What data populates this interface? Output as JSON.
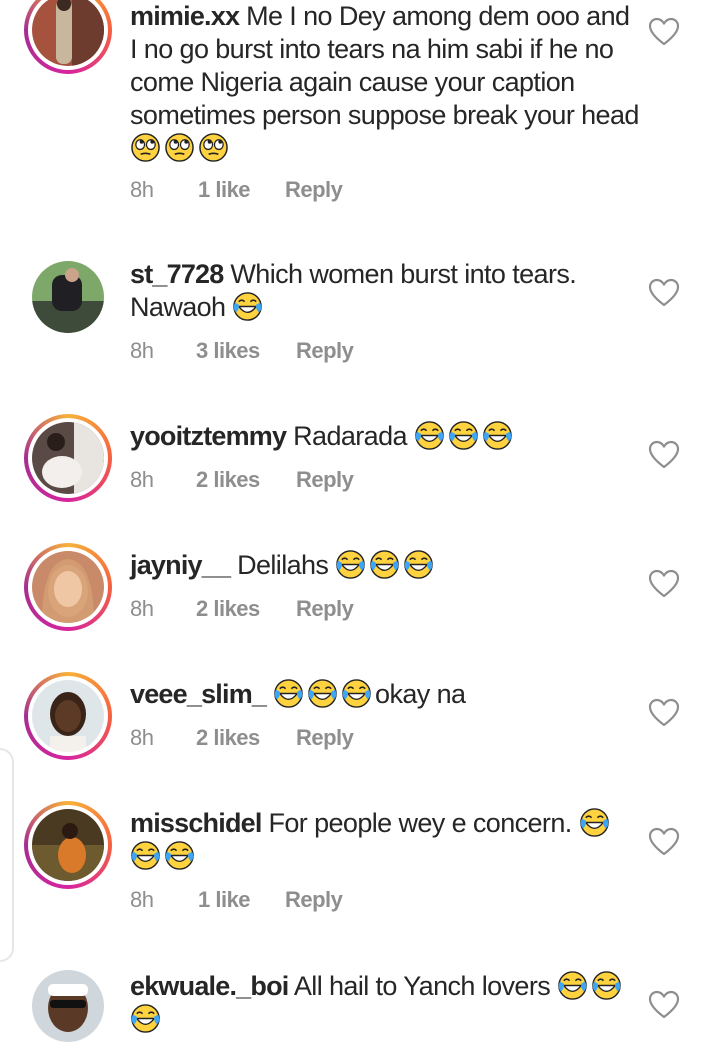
{
  "comments": [
    {
      "username": "mimie.xx",
      "text": "Me I no Dey among dem ooo and I no go burst into tears na him sabi if he no come Nigeria again cause your caption sometimes person suppose break your head",
      "emojis": [
        "rolling-eyes",
        "rolling-eyes",
        "rolling-eyes"
      ],
      "time": "8h",
      "likes": "1 like",
      "reply": "Reply"
    },
    {
      "username": "st_7728",
      "text": "Which women burst into tears. Nawaoh",
      "emojis": [
        "tears-of-joy"
      ],
      "time": "8h",
      "likes": "3 likes",
      "reply": "Reply"
    },
    {
      "username": "yooitztemmy",
      "text": "Radarada",
      "emojis": [
        "tears-of-joy",
        "tears-of-joy",
        "tears-of-joy"
      ],
      "time": "8h",
      "likes": "2 likes",
      "reply": "Reply"
    },
    {
      "username": "jayniy__",
      "text": "Delilahs",
      "emojis": [
        "tears-of-joy",
        "tears-of-joy",
        "tears-of-joy"
      ],
      "time": "8h",
      "likes": "2 likes",
      "reply": "Reply"
    },
    {
      "username": "veee_slim_",
      "text": "okay na",
      "emojis": [
        "tears-of-joy",
        "tears-of-joy",
        "tears-of-joy"
      ],
      "time": "8h",
      "likes": "2 likes",
      "reply": "Reply"
    },
    {
      "username": "misschidel",
      "text": "For people wey e concern.",
      "emojis": [
        "tears-of-joy",
        "tears-of-joy",
        "tears-of-joy"
      ],
      "time": "8h",
      "likes": "1 like",
      "reply": "Reply"
    },
    {
      "username": "ekwuale._boi",
      "text": "All hail to Yanch lovers",
      "emojis": [
        "tears-of-joy",
        "tears-of-joy",
        "tears-of-joy"
      ],
      "time": "",
      "likes": "",
      "reply": ""
    }
  ],
  "icons": {
    "like": "heart-outline-icon",
    "emoji_laugh": "tears-of-joy",
    "emoji_eyeroll": "rolling-eyes"
  },
  "colors": {
    "text": "#262626",
    "meta": "#8e8e8e",
    "story_ring": "#d6249f"
  }
}
